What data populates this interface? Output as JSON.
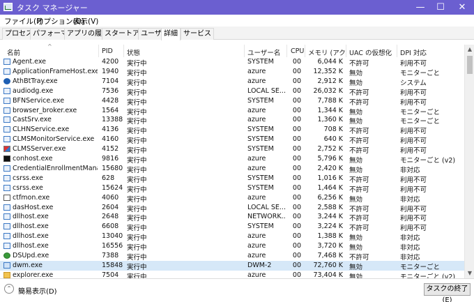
{
  "window": {
    "title": "タスク マネージャー",
    "buttons": [
      "—",
      "☐",
      "✕"
    ]
  },
  "menu": [
    "ファイル(F)",
    "オプション(O)",
    "表示(V)"
  ],
  "tabs": [
    "プロセス",
    "パフォーマンス",
    "アプリの履歴",
    "スタートアップ",
    "ユーザー",
    "詳細",
    "サービス"
  ],
  "active_tab": "詳細",
  "columns": [
    "名前",
    "PID",
    "状態",
    "ユーザー名",
    "CPU",
    "メモリ (アクテ...",
    "UAC の仮想化",
    "DPI 対応"
  ],
  "rows": [
    {
      "icon": "app-icon",
      "name": "Agent.exe",
      "pid": "4200",
      "status": "実行中",
      "user": "SYSTEM",
      "cpu": "00",
      "mem": "6,044 K",
      "uac": "不許可",
      "dpi": "利用不可"
    },
    {
      "icon": "app-icon",
      "name": "ApplicationFrameHost.exe",
      "pid": "1940",
      "status": "実行中",
      "user": "azure",
      "cpu": "00",
      "mem": "12,352 K",
      "uac": "無効",
      "dpi": "モニターごと"
    },
    {
      "icon": "bluetooth-icon",
      "name": "AthBtTray.exe",
      "pid": "7104",
      "status": "実行中",
      "user": "azure",
      "cpu": "00",
      "mem": "2,912 K",
      "uac": "無効",
      "dpi": "システム"
    },
    {
      "icon": "app-icon",
      "name": "audiodg.exe",
      "pid": "7536",
      "status": "実行中",
      "user": "LOCAL SE...",
      "cpu": "00",
      "mem": "26,032 K",
      "uac": "不許可",
      "dpi": "利用不可"
    },
    {
      "icon": "app-icon",
      "name": "BFNService.exe",
      "pid": "4428",
      "status": "実行中",
      "user": "SYSTEM",
      "cpu": "00",
      "mem": "7,788 K",
      "uac": "不許可",
      "dpi": "利用不可"
    },
    {
      "icon": "app-icon",
      "name": "browser_broker.exe",
      "pid": "1564",
      "status": "実行中",
      "user": "azure",
      "cpu": "00",
      "mem": "1,344 K",
      "uac": "無効",
      "dpi": "モニターごと"
    },
    {
      "icon": "app-icon",
      "name": "CastSrv.exe",
      "pid": "13388",
      "status": "実行中",
      "user": "azure",
      "cpu": "00",
      "mem": "1,360 K",
      "uac": "無効",
      "dpi": "モニターごと"
    },
    {
      "icon": "app-icon",
      "name": "CLHNService.exe",
      "pid": "4136",
      "status": "実行中",
      "user": "SYSTEM",
      "cpu": "00",
      "mem": "708 K",
      "uac": "不許可",
      "dpi": "利用不可"
    },
    {
      "icon": "app-icon",
      "name": "CLMSMonitorService.exe",
      "pid": "4160",
      "status": "実行中",
      "user": "SYSTEM",
      "cpu": "00",
      "mem": "640 K",
      "uac": "不許可",
      "dpi": "利用不可"
    },
    {
      "icon": "colorful-app-icon",
      "name": "CLMSServer.exe",
      "pid": "4152",
      "status": "実行中",
      "user": "SYSTEM",
      "cpu": "00",
      "mem": "2,752 K",
      "uac": "不許可",
      "dpi": "利用不可"
    },
    {
      "icon": "console-icon",
      "name": "conhost.exe",
      "pid": "9816",
      "status": "実行中",
      "user": "azure",
      "cpu": "00",
      "mem": "5,796 K",
      "uac": "無効",
      "dpi": "モニターごと (v2)"
    },
    {
      "icon": "app-icon",
      "name": "CredentialEnrollmentManager...",
      "pid": "15680",
      "status": "実行中",
      "user": "azure",
      "cpu": "00",
      "mem": "2,420 K",
      "uac": "無効",
      "dpi": "非対応"
    },
    {
      "icon": "app-icon",
      "name": "csrss.exe",
      "pid": "628",
      "status": "実行中",
      "user": "SYSTEM",
      "cpu": "00",
      "mem": "1,016 K",
      "uac": "不許可",
      "dpi": "利用不可"
    },
    {
      "icon": "app-icon",
      "name": "csrss.exe",
      "pid": "15624",
      "status": "実行中",
      "user": "SYSTEM",
      "cpu": "00",
      "mem": "1,464 K",
      "uac": "不許可",
      "dpi": "利用不可"
    },
    {
      "icon": "pen-icon",
      "name": "ctfmon.exe",
      "pid": "4060",
      "status": "実行中",
      "user": "azure",
      "cpu": "00",
      "mem": "6,256 K",
      "uac": "無効",
      "dpi": "非対応"
    },
    {
      "icon": "app-icon",
      "name": "dasHost.exe",
      "pid": "2604",
      "status": "実行中",
      "user": "LOCAL SE...",
      "cpu": "00",
      "mem": "2,588 K",
      "uac": "不許可",
      "dpi": "利用不可"
    },
    {
      "icon": "app-icon",
      "name": "dllhost.exe",
      "pid": "2648",
      "status": "実行中",
      "user": "NETWORK...",
      "cpu": "00",
      "mem": "3,244 K",
      "uac": "不許可",
      "dpi": "利用不可"
    },
    {
      "icon": "app-icon",
      "name": "dllhost.exe",
      "pid": "6608",
      "status": "実行中",
      "user": "SYSTEM",
      "cpu": "00",
      "mem": "3,224 K",
      "uac": "不許可",
      "dpi": "利用不可"
    },
    {
      "icon": "app-icon",
      "name": "dllhost.exe",
      "pid": "13040",
      "status": "実行中",
      "user": "azure",
      "cpu": "00",
      "mem": "1,388 K",
      "uac": "無効",
      "dpi": "非対応"
    },
    {
      "icon": "app-icon",
      "name": "dllhost.exe",
      "pid": "16556",
      "status": "実行中",
      "user": "azure",
      "cpu": "00",
      "mem": "3,720 K",
      "uac": "無効",
      "dpi": "非対応"
    },
    {
      "icon": "shield-icon",
      "name": "DSUpd.exe",
      "pid": "7388",
      "status": "実行中",
      "user": "azure",
      "cpu": "00",
      "mem": "7,468 K",
      "uac": "不許可",
      "dpi": "非対応"
    },
    {
      "icon": "dwm-icon",
      "name": "dwm.exe",
      "pid": "15848",
      "status": "実行中",
      "user": "DWM-2",
      "cpu": "00",
      "mem": "72,760 K",
      "uac": "無効",
      "dpi": "モニターごと"
    },
    {
      "icon": "folder-icon",
      "name": "explorer.exe",
      "pid": "7504",
      "status": "実行中",
      "user": "azure",
      "cpu": "00",
      "mem": "73,404 K",
      "uac": "無効",
      "dpi": "モニターごと (v2)"
    }
  ],
  "selected_row": 21,
  "footer": {
    "collapse_label": "簡易表示(D)",
    "end_task_label": "タスクの終了(E)"
  }
}
